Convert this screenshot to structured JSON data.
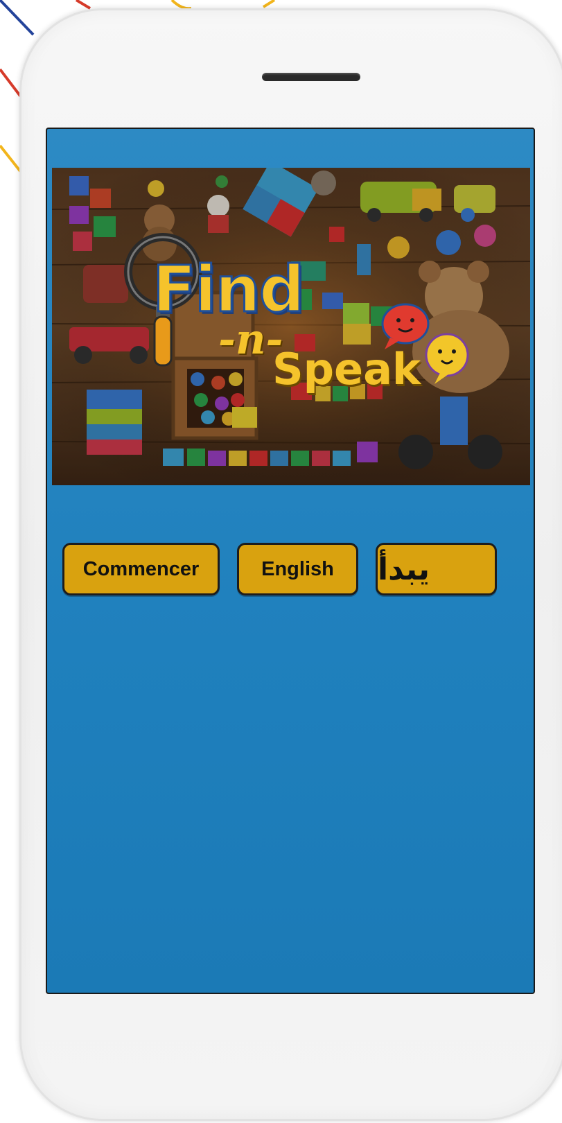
{
  "app": {
    "logo": {
      "find": "Find",
      "connector": "-n-",
      "speak": "Speak"
    }
  },
  "buttons": {
    "french_label": "Commencer",
    "english_label": "English",
    "arabic_label": "يبدأ"
  },
  "colors": {
    "screen_background": "#1f80bd",
    "button_fill": "#d9a20f",
    "button_border": "#1d1d1d",
    "logo_yellow": "#f5c32c"
  },
  "icons": {
    "magnifier": "magnifier-icon",
    "speech_bubble_red": "speech-bubble-red-icon",
    "speech_bubble_yellow": "speech-bubble-yellow-icon"
  }
}
